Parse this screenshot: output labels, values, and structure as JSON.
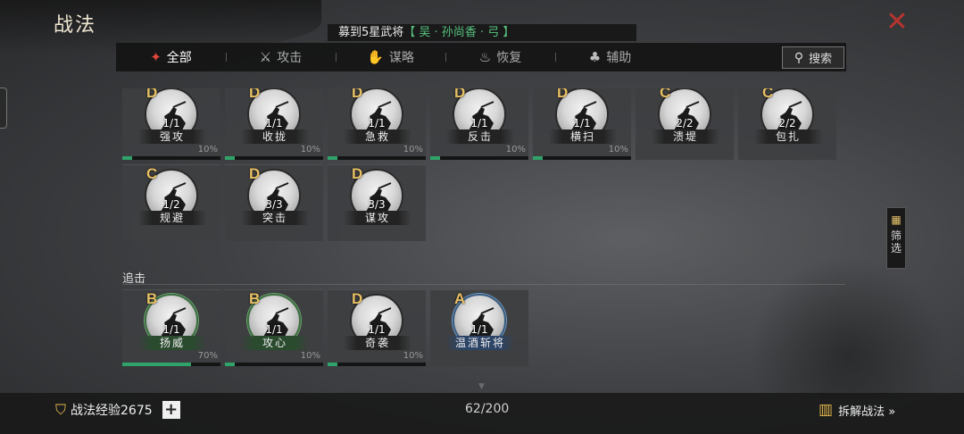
{
  "title": "战法",
  "recruit_banner": {
    "prefix": "募到5星武将",
    "highlight": "【 吴 · 孙尚香 · 弓 】"
  },
  "tabs": [
    {
      "label": "全部",
      "icon": "scroll-icon",
      "glyph": "✦",
      "active": true
    },
    {
      "label": "攻击",
      "icon": "crossed-swords-icon",
      "glyph": "⚔",
      "active": false
    },
    {
      "label": "谋略",
      "icon": "hand-icon",
      "glyph": "✋",
      "active": false
    },
    {
      "label": "恢复",
      "icon": "bowl-icon",
      "glyph": "♨",
      "active": false
    },
    {
      "label": "辅助",
      "icon": "bag-icon",
      "glyph": "♣",
      "active": false
    }
  ],
  "search": {
    "label": "搜索",
    "icon": "search-icon",
    "glyph": "⚲"
  },
  "filter": {
    "label_1": "筛",
    "label_2": "选",
    "icon": "grid-icon",
    "glyph": "▦"
  },
  "rows": [
    {
      "cards": [
        {
          "rank": "D",
          "count": "1/1",
          "name": "强攻",
          "pct": "10%",
          "progress": 0.1,
          "frame": "plain"
        },
        {
          "rank": "D",
          "count": "1/1",
          "name": "收拢",
          "pct": "10%",
          "progress": 0.1,
          "frame": "plain"
        },
        {
          "rank": "D",
          "count": "1/1",
          "name": "急救",
          "pct": "10%",
          "progress": 0.1,
          "frame": "plain"
        },
        {
          "rank": "D",
          "count": "1/1",
          "name": "反击",
          "pct": "10%",
          "progress": 0.1,
          "frame": "plain"
        },
        {
          "rank": "D",
          "count": "1/1",
          "name": "横扫",
          "pct": "10%",
          "progress": 0.1,
          "frame": "plain"
        },
        {
          "rank": "C",
          "count": "2/2",
          "name": "溃堤",
          "pct": "",
          "progress": null,
          "frame": "plain"
        },
        {
          "rank": "C",
          "count": "2/2",
          "name": "包扎",
          "pct": "",
          "progress": null,
          "frame": "plain"
        }
      ]
    },
    {
      "cards": [
        {
          "rank": "C",
          "count": "1/2",
          "name": "规避",
          "pct": "",
          "progress": null,
          "frame": "plain"
        },
        {
          "rank": "D",
          "count": "3/3",
          "name": "突击",
          "pct": "",
          "progress": null,
          "frame": "plain"
        },
        {
          "rank": "D",
          "count": "3/3",
          "name": "谋攻",
          "pct": "",
          "progress": null,
          "frame": "plain"
        }
      ]
    },
    {
      "cards": [
        {
          "rank": "B",
          "count": "1/1",
          "name": "扬威",
          "pct": "70%",
          "progress": 0.7,
          "frame": "green"
        },
        {
          "rank": "B",
          "count": "1/1",
          "name": "攻心",
          "pct": "10%",
          "progress": 0.1,
          "frame": "green"
        },
        {
          "rank": "D",
          "count": "1/1",
          "name": "奇袭",
          "pct": "10%",
          "progress": 0.1,
          "frame": "plain"
        },
        {
          "rank": "A",
          "count": "1/1",
          "name": "温酒斩将",
          "pct": "",
          "progress": null,
          "frame": "blue"
        }
      ]
    }
  ],
  "section": {
    "label": "追击"
  },
  "bottom": {
    "exp_label": "战法经验2675",
    "exp_icon": "shield-exp-icon",
    "plus": "+",
    "capacity": "62/200",
    "dismantle_label": "拆解战法 »",
    "dismantle_icon": "scroll-bundle-icon"
  },
  "colors": {
    "accent_red": "#b8342e",
    "progress_green": "#2fa36a",
    "rank_gold": "#e7c064",
    "banner_green": "#58c27d"
  }
}
